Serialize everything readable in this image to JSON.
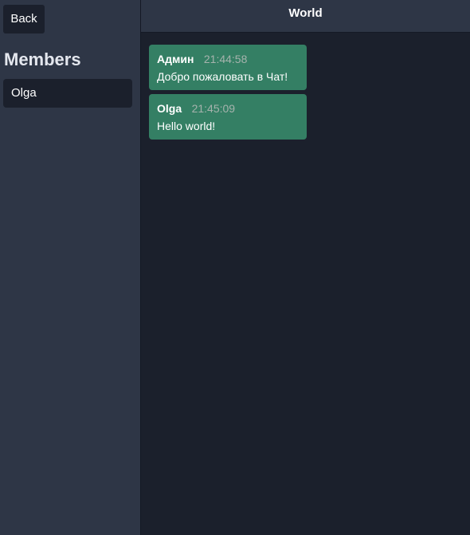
{
  "sidebar": {
    "back_label": "Back",
    "members_heading": "Members",
    "members": [
      {
        "name": "Olga"
      }
    ]
  },
  "chat": {
    "title": "World",
    "messages": [
      {
        "author": "Админ",
        "time": "21:44:58",
        "text": "Добро пожаловать в Чат!"
      },
      {
        "author": "Olga",
        "time": "21:45:09",
        "text": "Hello world!"
      }
    ]
  },
  "colors": {
    "sidebar_bg": "#2e3646",
    "main_bg": "#1b202c",
    "message_bg": "#347f64",
    "timestamp": "#a6b3ad"
  }
}
